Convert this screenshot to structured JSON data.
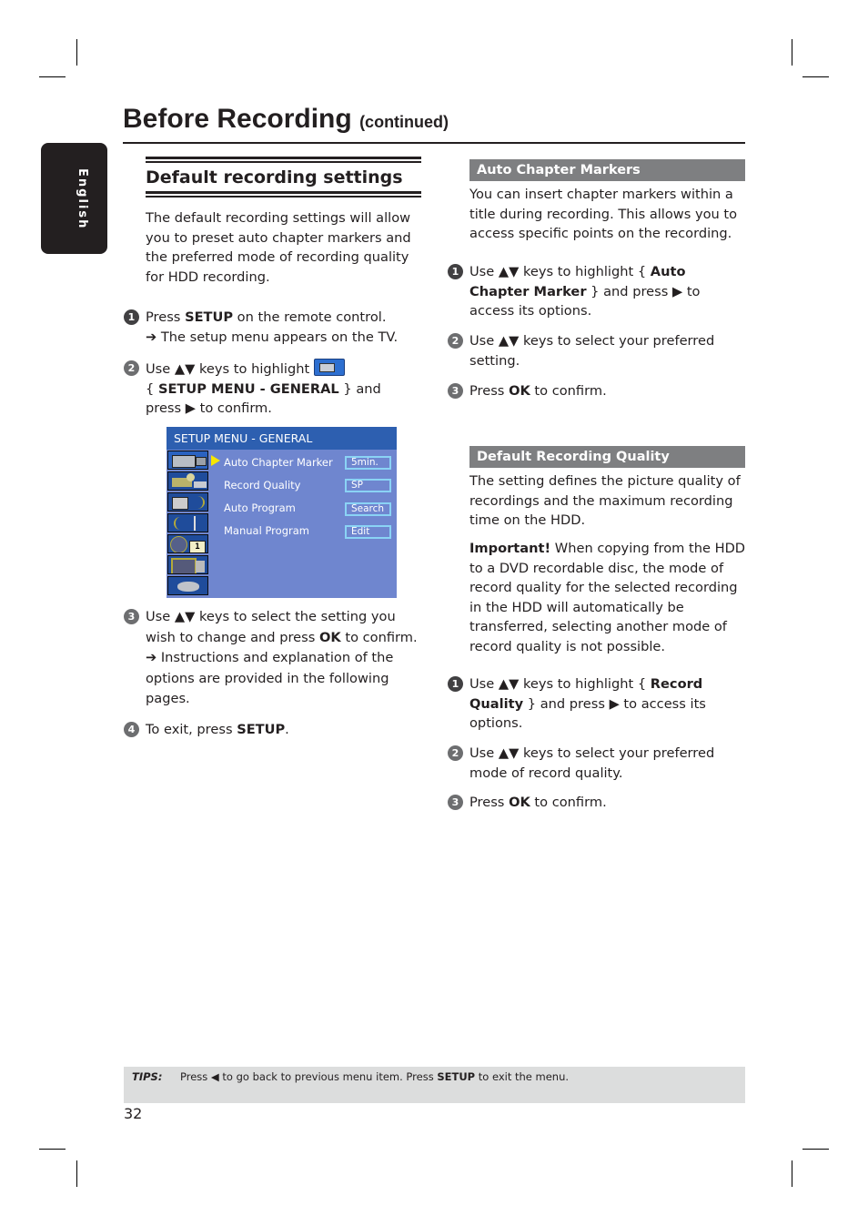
{
  "page": {
    "title": "Before Recording",
    "title_suffix": "(continued)",
    "language_tab": "English",
    "page_number": "32"
  },
  "left_column": {
    "section_title": "Default recording settings",
    "intro": "The default recording settings will allow you to preset auto chapter markers and the preferred mode of recording quality for HDD recording.",
    "steps": [
      {
        "number": "1",
        "parts": [
          "Press ",
          "SETUP",
          " on the remote control."
        ],
        "result": "➔ The setup menu appears on the TV."
      },
      {
        "number": "2",
        "parts": [
          "Use ▲▼ keys to highlight ",
          "{ ",
          "SETUP MENU - GENERAL",
          " } and press ▶ to confirm."
        ],
        "icon": "setup-general-icon"
      },
      {
        "number": "3",
        "parts": [
          "Use ▲▼ keys to select the setting you wish to change and press ",
          "OK",
          " to confirm."
        ],
        "result": "➔ Instructions and explanation of the options are provided in the following pages."
      },
      {
        "number": "4",
        "parts": [
          "To exit, press ",
          "SETUP",
          "."
        ]
      }
    ]
  },
  "tv_menu": {
    "title": "SETUP MENU - GENERAL",
    "icons": [
      "camcorder-icon",
      "projector-icon",
      "speaker-icon",
      "signal-icon",
      "clock-calendar-icon",
      "tv-remote-icon",
      "disc-stack-icon"
    ],
    "selected_index": 0,
    "items": [
      {
        "label": "Auto Chapter Marker",
        "value": "5min."
      },
      {
        "label": "Record Quality",
        "value": "SP"
      },
      {
        "label": "Auto Program",
        "value": "Search"
      },
      {
        "label": "Manual Program",
        "value": "Edit"
      }
    ]
  },
  "right_column": {
    "auto_chapter": {
      "header": "Auto Chapter Markers",
      "intro": "You can insert chapter markers within a title during recording. This allows you to access specific points on the recording.",
      "steps": [
        {
          "number": "1",
          "parts": [
            "Use ▲▼ keys to highlight { ",
            "Auto Chapter Marker",
            " } and press ▶ to access its options."
          ]
        },
        {
          "number": "2",
          "parts": [
            "Use ▲▼ keys to select your preferred setting."
          ]
        },
        {
          "number": "3",
          "parts": [
            "Press ",
            "OK",
            " to confirm."
          ]
        }
      ]
    },
    "record_quality": {
      "header": "Default Recording Quality",
      "intro": "The setting defines the picture quality of recordings and the maximum recording time on the HDD.",
      "important_label": "Important!",
      "important_text": " When copying from the HDD to a DVD recordable disc, the mode of record quality for the selected recording in the HDD will automatically be transferred, selecting another mode of record quality is not possible.",
      "steps": [
        {
          "number": "1",
          "parts": [
            "Use ▲▼ keys to highlight { ",
            "Record Quality",
            " } and press ▶ to access its options."
          ]
        },
        {
          "number": "2",
          "parts": [
            "Use ▲▼ keys to select your preferred mode of record quality."
          ]
        },
        {
          "number": "3",
          "parts": [
            "Press ",
            "OK",
            " to confirm."
          ]
        }
      ]
    }
  },
  "tips": {
    "label": "TIPS:",
    "parts": [
      "Press ◀ to go back to previous menu item. Press ",
      "SETUP",
      " to exit the menu."
    ]
  }
}
